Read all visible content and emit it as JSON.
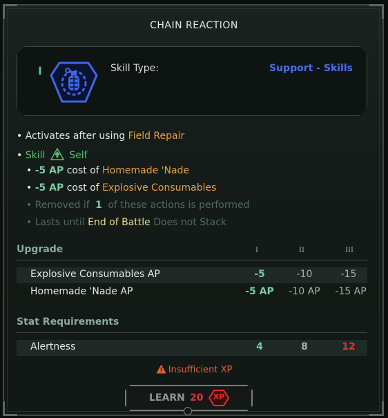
{
  "title": "CHAIN REACTION",
  "tier_glyph": "I",
  "skill_type": {
    "label": "Skill Type:",
    "value": "Support - Skills"
  },
  "effects": {
    "activates": {
      "prefix": "• Activates after using",
      "target": "Field Repair"
    },
    "skill_line": {
      "bullet": "•",
      "skill": "Skill",
      "scope": "Self"
    },
    "cost1": {
      "bullet": "•",
      "amount": "-5 AP",
      "mid": "cost of",
      "target": "Homemade 'Nade"
    },
    "cost2": {
      "bullet": "•",
      "amount": "-5 AP",
      "mid": "cost of",
      "target": "Explosive Consumables"
    },
    "removed": {
      "bullet": "•",
      "prefix": "Removed if",
      "count": "1",
      "suffix": "of these actions is performed"
    },
    "lasts": {
      "bullet": "•",
      "prefix": "Lasts until",
      "duration": "End of Battle",
      "suffix": "Does not Stack"
    }
  },
  "upgrade": {
    "title": "Upgrade",
    "levels": [
      "I",
      "II",
      "III"
    ],
    "rows": [
      {
        "name": "Explosive Consumables AP",
        "values": [
          "-5",
          "-10",
          "-15"
        ]
      },
      {
        "name": "Homemade 'Nade AP",
        "values": [
          "-5 AP",
          "-10 AP",
          "-15 AP"
        ]
      }
    ]
  },
  "requirements": {
    "title": "Stat Requirements",
    "rows": [
      {
        "name": "Alertness",
        "values": [
          "4",
          "8",
          "12"
        ]
      }
    ]
  },
  "warning": "Insufficient XP",
  "learn": {
    "label": "LEARN",
    "cost": "20",
    "unit": "XP"
  },
  "colors": {
    "accent_green": "#59c06e",
    "accent_orange": "#e2a24b",
    "skill_type_blue": "#4a6ee8",
    "warning_red": "#e4613a",
    "cost_red": "#e2312c"
  }
}
